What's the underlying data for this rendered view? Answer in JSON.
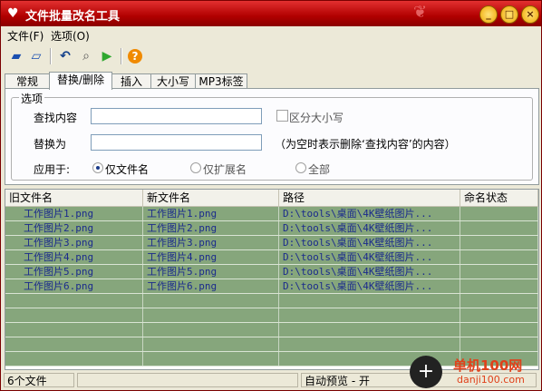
{
  "window": {
    "title": "文件批量改名工具"
  },
  "menu": {
    "file": "文件(F)",
    "options": "选项(O)"
  },
  "tabs": [
    "常规",
    "替换/删除",
    "插入",
    "大小写",
    "MP3标签"
  ],
  "options_group": {
    "title": "选项",
    "find_label": "查找内容",
    "find_value": "",
    "case_label": "区分大小写",
    "replace_label": "替换为",
    "replace_value": "",
    "replace_hint": "（为空时表示删除‘查找内容’的内容）",
    "apply_label": "应用于:",
    "apply_options": [
      "仅文件名",
      "仅扩展名",
      "全部"
    ],
    "apply_selected": "仅文件名"
  },
  "table": {
    "columns": [
      "旧文件名",
      "新文件名",
      "路径",
      "命名状态"
    ],
    "rows": [
      [
        "工作图片1.png",
        "工作图片1.png",
        "D:\\tools\\桌面\\4K壁纸图片...",
        ""
      ],
      [
        "工作图片2.png",
        "工作图片2.png",
        "D:\\tools\\桌面\\4K壁纸图片...",
        ""
      ],
      [
        "工作图片3.png",
        "工作图片3.png",
        "D:\\tools\\桌面\\4K壁纸图片...",
        ""
      ],
      [
        "工作图片4.png",
        "工作图片4.png",
        "D:\\tools\\桌面\\4K壁纸图片...",
        ""
      ],
      [
        "工作图片5.png",
        "工作图片5.png",
        "D:\\tools\\桌面\\4K壁纸图片...",
        ""
      ],
      [
        "工作图片6.png",
        "工作图片6.png",
        "D:\\tools\\桌面\\4K壁纸图片...",
        ""
      ]
    ]
  },
  "status": {
    "count": "6个文件",
    "preview": "自动预览 - 开"
  },
  "watermark": {
    "text": "单机100网",
    "sub": "danji100.com"
  },
  "colors": {
    "title_bar": "#b10000",
    "row_fill": "#86a67c",
    "row_text": "#1b2b8c"
  }
}
